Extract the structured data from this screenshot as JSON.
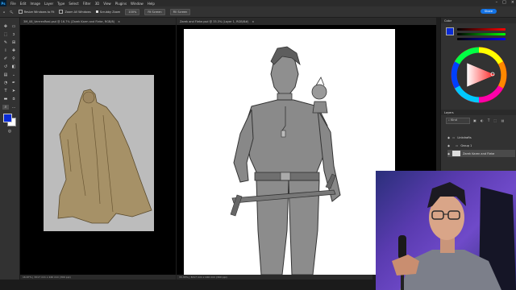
{
  "menu": {
    "items": [
      "File",
      "Edit",
      "Image",
      "Layer",
      "Type",
      "Select",
      "Filter",
      "3D",
      "View",
      "Plugins",
      "Window",
      "Help"
    ],
    "window_controls": [
      "–",
      "□",
      "×"
    ]
  },
  "options": {
    "resize_windows_label": "Resize Windows to Fit",
    "zoom_all_windows_label": "Zoom All Windows",
    "scrubby_zoom_label": "Scrubby Zoom",
    "zoom_value": "100%",
    "fit_screen_label": "Fit Screen",
    "fill_screen_label": "Fill Screen",
    "share_label": "Share"
  },
  "documents": [
    {
      "tab_title": "3M_08_VerrrenReal.psd @ 16.7% (Zarek Karm and Fleke, RGB/8)",
      "status": "16.67% | 3217 mm x 240 mm (300 ppi)"
    },
    {
      "tab_title": "Zarek and Fleke.psd @ 33.3% (Layer 1, RGB/8#)",
      "status": "33.33% | 3217 mm x 240 mm (300 ppi)"
    }
  ],
  "panels": {
    "color_label": "Color",
    "layers_label": "Layers",
    "search_kind": "Kind",
    "layers": [
      {
        "name": "Linkdrafts"
      },
      {
        "name": "Group 1"
      },
      {
        "name": "Zarek Karen and Fleke"
      }
    ]
  },
  "colors": {
    "accent": "#1473e6",
    "webcam_glow": "#6f4ac9",
    "sepia_figure": "#a69167",
    "fg_swatch": "#0a2bd6"
  }
}
